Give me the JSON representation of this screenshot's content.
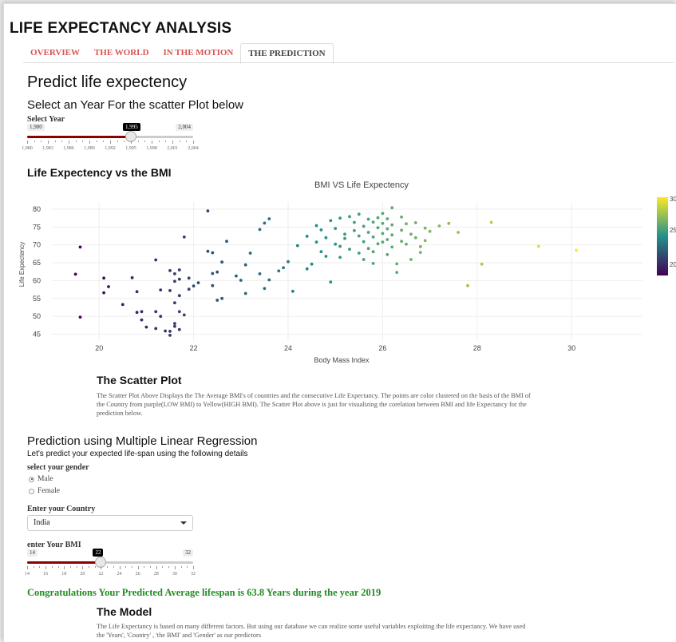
{
  "app": {
    "title": "LIFE EXPECTANCY ANALYSIS"
  },
  "tabs": [
    {
      "label": "OVERVIEW",
      "active": false
    },
    {
      "label": "THE WORLD",
      "active": false
    },
    {
      "label": "IN THE MOTION",
      "active": false
    },
    {
      "label": "THE PREDICTION",
      "active": true
    }
  ],
  "page": {
    "heading": "Predict life expectency",
    "year_section_heading": "Select an Year For the scatter Plot below",
    "year_label": "Select Year",
    "chart_section_heading": "Life Expectency vs the BMI"
  },
  "year_slider": {
    "min": 1980,
    "max": 2004,
    "value": 1995,
    "min_label": "1,980",
    "max_label": "2,004",
    "value_label": "1,995",
    "tick_labels": [
      "1,980",
      "1,983",
      "1,986",
      "1,989",
      "1,992",
      "1,995",
      "1,998",
      "2,001",
      "2,004"
    ]
  },
  "chart_data": {
    "type": "scatter",
    "title": "BMI VS Life Expectency",
    "xlabel": "Body Mass Index",
    "ylabel": "Life Expectency",
    "xlim": [
      19,
      31.5
    ],
    "ylim": [
      44,
      82
    ],
    "xticks": [
      20,
      22,
      24,
      26,
      28,
      30
    ],
    "yticks": [
      45,
      50,
      55,
      60,
      65,
      70,
      75,
      80
    ],
    "colorscale": {
      "low": "#440154",
      "mid": "#21918c",
      "high": "#fde725",
      "min": 19.5,
      "max": 30
    },
    "colorbar_ticks": [
      "30",
      "25",
      "20"
    ],
    "grid": true,
    "points": [
      [
        19.6,
        69.4
      ],
      [
        19.5,
        61.8
      ],
      [
        19.6,
        49.8
      ],
      [
        20.1,
        60.7
      ],
      [
        20.2,
        58.3
      ],
      [
        20.1,
        56.6
      ],
      [
        20.5,
        53.3
      ],
      [
        20.7,
        60.8
      ],
      [
        20.8,
        51.1
      ],
      [
        20.9,
        51.3
      ],
      [
        20.8,
        56.9
      ],
      [
        20.9,
        49.0
      ],
      [
        21.0,
        47.0
      ],
      [
        21.2,
        46.6
      ],
      [
        21.2,
        51.3
      ],
      [
        21.3,
        50.0
      ],
      [
        21.4,
        45.9
      ],
      [
        21.3,
        57.4
      ],
      [
        21.2,
        65.8
      ],
      [
        21.5,
        44.7
      ],
      [
        21.5,
        62.8
      ],
      [
        21.6,
        61.9
      ],
      [
        21.5,
        57.2
      ],
      [
        21.6,
        59.8
      ],
      [
        21.7,
        63.0
      ],
      [
        21.7,
        55.8
      ],
      [
        21.6,
        53.8
      ],
      [
        21.7,
        51.3
      ],
      [
        21.8,
        50.4
      ],
      [
        21.6,
        48.0
      ],
      [
        21.6,
        47.2
      ],
      [
        21.5,
        45.8
      ],
      [
        21.7,
        46.3
      ],
      [
        21.9,
        60.7
      ],
      [
        22.0,
        58.5
      ],
      [
        21.9,
        57.6
      ],
      [
        21.8,
        72.2
      ],
      [
        22.1,
        59.4
      ],
      [
        21.7,
        60.4
      ],
      [
        22.3,
        79.5
      ],
      [
        22.3,
        68.2
      ],
      [
        22.4,
        67.8
      ],
      [
        22.4,
        62.0
      ],
      [
        22.5,
        62.4
      ],
      [
        22.4,
        58.6
      ],
      [
        22.5,
        54.5
      ],
      [
        22.6,
        55.0
      ],
      [
        22.6,
        65.2
      ],
      [
        22.7,
        71.0
      ],
      [
        22.9,
        61.3
      ],
      [
        23.0,
        60.1
      ],
      [
        23.1,
        56.4
      ],
      [
        23.1,
        64.4
      ],
      [
        23.2,
        67.7
      ],
      [
        23.4,
        74.3
      ],
      [
        23.5,
        76.1
      ],
      [
        23.6,
        77.3
      ],
      [
        23.4,
        61.9
      ],
      [
        23.5,
        57.8
      ],
      [
        23.6,
        60.2
      ],
      [
        23.8,
        62.7
      ],
      [
        23.9,
        63.6
      ],
      [
        24.0,
        65.3
      ],
      [
        24.1,
        57.0
      ],
      [
        24.2,
        69.8
      ],
      [
        24.4,
        72.4
      ],
      [
        24.4,
        63.3
      ],
      [
        24.5,
        64.6
      ],
      [
        24.6,
        75.4
      ],
      [
        24.6,
        70.8
      ],
      [
        24.7,
        74.2
      ],
      [
        24.7,
        68.1
      ],
      [
        24.8,
        72.0
      ],
      [
        24.8,
        66.8
      ],
      [
        24.9,
        59.6
      ],
      [
        24.9,
        76.8
      ],
      [
        25.0,
        74.6
      ],
      [
        25.0,
        70.2
      ],
      [
        25.1,
        77.5
      ],
      [
        25.1,
        69.6
      ],
      [
        25.1,
        66.5
      ],
      [
        25.2,
        73.0
      ],
      [
        25.2,
        71.8
      ],
      [
        25.3,
        77.9
      ],
      [
        25.3,
        68.8
      ],
      [
        25.4,
        76.3
      ],
      [
        25.4,
        74.0
      ],
      [
        25.5,
        78.6
      ],
      [
        25.5,
        72.5
      ],
      [
        25.5,
        67.7
      ],
      [
        25.6,
        75.2
      ],
      [
        25.6,
        70.9
      ],
      [
        25.6,
        65.9
      ],
      [
        25.7,
        77.2
      ],
      [
        25.7,
        73.5
      ],
      [
        25.7,
        69.0
      ],
      [
        25.8,
        76.4
      ],
      [
        25.8,
        72.2
      ],
      [
        25.8,
        68.1
      ],
      [
        25.8,
        64.8
      ],
      [
        25.9,
        77.6
      ],
      [
        25.9,
        74.8
      ],
      [
        25.9,
        70.3
      ],
      [
        26.0,
        78.8
      ],
      [
        26.0,
        76.0
      ],
      [
        26.0,
        73.2
      ],
      [
        26.0,
        70.8
      ],
      [
        26.1,
        77.3
      ],
      [
        26.1,
        74.5
      ],
      [
        26.1,
        71.5
      ],
      [
        26.1,
        67.3
      ],
      [
        26.2,
        80.4
      ],
      [
        26.2,
        75.6
      ],
      [
        26.2,
        72.8
      ],
      [
        26.2,
        69.4
      ],
      [
        26.3,
        64.7
      ],
      [
        26.3,
        62.3
      ],
      [
        26.4,
        77.8
      ],
      [
        26.4,
        74.1
      ],
      [
        26.4,
        71.0
      ],
      [
        26.5,
        75.9
      ],
      [
        26.5,
        70.2
      ],
      [
        26.6,
        73.0
      ],
      [
        26.6,
        65.9
      ],
      [
        26.7,
        76.2
      ],
      [
        26.7,
        72.0
      ],
      [
        26.8,
        69.5
      ],
      [
        26.8,
        67.9
      ],
      [
        26.9,
        74.7
      ],
      [
        26.9,
        71.2
      ],
      [
        27.0,
        73.8
      ],
      [
        27.2,
        75.3
      ],
      [
        27.4,
        76.0
      ],
      [
        27.6,
        73.5
      ],
      [
        27.8,
        58.6
      ],
      [
        28.1,
        64.6
      ],
      [
        28.3,
        76.3
      ],
      [
        29.3,
        69.6
      ],
      [
        30.1,
        68.5
      ]
    ]
  },
  "scatter_text": {
    "heading": "The Scatter Plot",
    "body": "The Scatter Plot Above Displays the The Average BMI's of countries and the consecutive Life Expectancy. The points are color clustered on the basis of the BMI of the Country from purple(LOW BMI) to Yellow(HIGH BMI). The Scatter Plot above is just for visualizing the corelation between BMI and life Expectancy for the prediction below."
  },
  "prediction": {
    "heading": "Prediction using Multiple Linear Regression",
    "subheading": "Let's predict your expected life-span using the following details",
    "gender_label": "select your gender",
    "gender_options": [
      {
        "label": "Male",
        "selected": true
      },
      {
        "label": "Female",
        "selected": false
      }
    ],
    "country_label": "Enter your Country",
    "country_value": "India",
    "bmi_label": "enter Your BMI",
    "result": "Congratulations Your Predicted Average lifespan is 63.8 Years during the year 2019"
  },
  "bmi_slider": {
    "min": 14,
    "max": 32,
    "value": 22,
    "min_label": "14",
    "max_label": "32",
    "value_label": "22",
    "tick_labels": [
      "14",
      "16",
      "18",
      "20",
      "22",
      "24",
      "26",
      "28",
      "30",
      "32"
    ]
  },
  "model": {
    "heading": "The Model",
    "body": "The Life Expectancy is based on many different factors. But using our database we can realize some useful variables exploiting the life expectancy. We have used the 'Years', 'Country' , 'the BMI' and 'Gender' as our predictors"
  }
}
